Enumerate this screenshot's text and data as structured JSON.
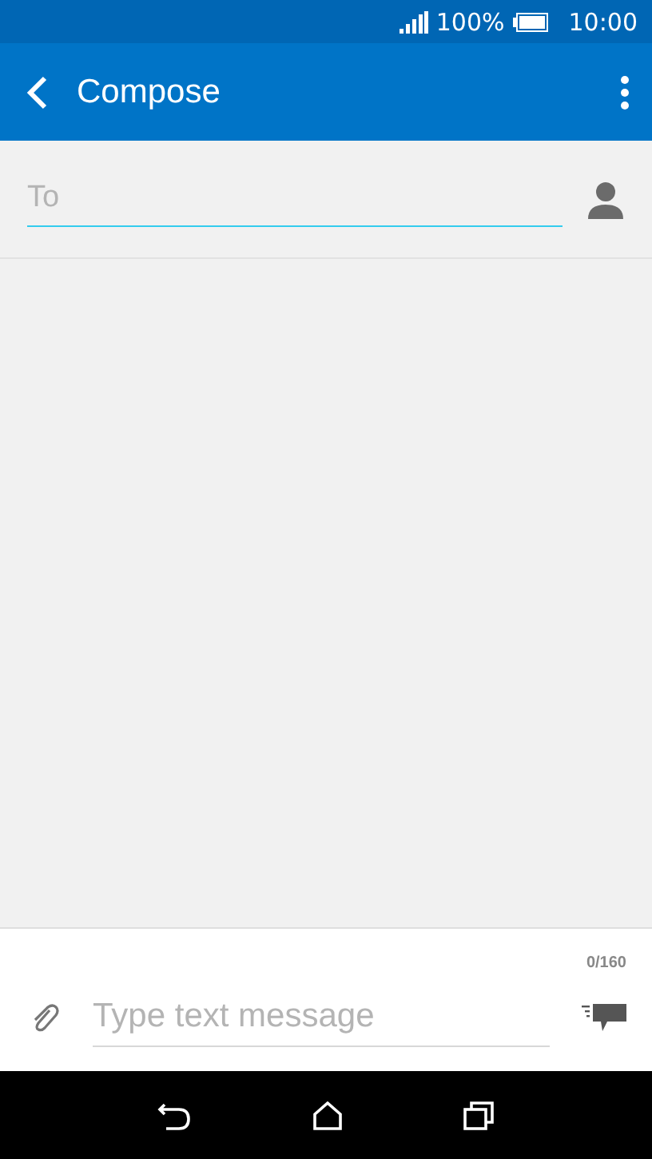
{
  "status_bar": {
    "battery": "100%",
    "time": "10:00"
  },
  "app_bar": {
    "title": "Compose"
  },
  "recipient": {
    "placeholder": "To"
  },
  "composer": {
    "counter": "0/160",
    "placeholder": "Type text message"
  }
}
